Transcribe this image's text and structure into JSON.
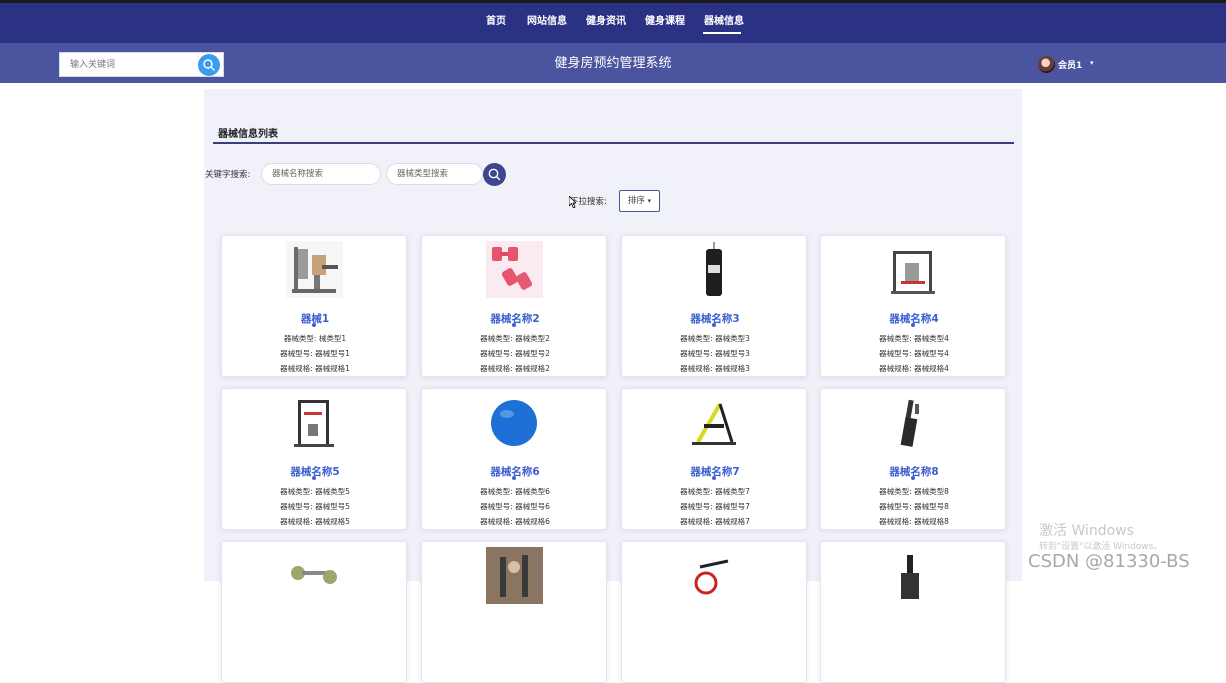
{
  "nav": {
    "items": [
      {
        "label": "首页"
      },
      {
        "label": "网站信息"
      },
      {
        "label": "健身资讯"
      },
      {
        "label": "健身课程"
      },
      {
        "label": "器械信息"
      }
    ],
    "active": "器械信息"
  },
  "header": {
    "search_placeholder": "输入关键词",
    "title": "健身房预约管理系统",
    "user_name": "会员1",
    "user_caret": "▾"
  },
  "main": {
    "section_title": "器械信息列表",
    "keyword_label": "关键字搜索:",
    "name_placeholder": "器械名称搜索",
    "type_placeholder": "器械类型搜索",
    "dropdown_label": "下拉搜索:",
    "sort_label": "排序",
    "sort_caret": "▾"
  },
  "cards": [
    {
      "name": "器械1",
      "type": "器械类型: 械类型1",
      "model": "器械型号: 器械型号1",
      "spec": "器械规格: 器械规格1",
      "icon": "cable-machine-icon"
    },
    {
      "name": "器械名称2",
      "type": "器械类型: 器械类型2",
      "model": "器械型号: 器械型号2",
      "spec": "器械规格: 器械规格2",
      "icon": "dumbbell-icon"
    },
    {
      "name": "器械名称3",
      "type": "器械类型: 器械类型3",
      "model": "器械型号: 器械型号3",
      "spec": "器械规格: 器械规格3",
      "icon": "punching-bag-icon"
    },
    {
      "name": "器械名称4",
      "type": "器械类型: 器械类型4",
      "model": "器械型号: 器械型号4",
      "spec": "器械规格: 器械规格4",
      "icon": "home-gym-icon"
    },
    {
      "name": "器械名称5",
      "type": "器械类型: 器械类型5",
      "model": "器械型号: 器械型号5",
      "spec": "器械规格: 器械规格5",
      "icon": "power-rack-icon"
    },
    {
      "name": "器械名称6",
      "type": "器械类型: 器械类型6",
      "model": "器械型号: 器械型号6",
      "spec": "器械规格: 器械规格6",
      "icon": "exercise-ball-icon"
    },
    {
      "name": "器械名称7",
      "type": "器械类型: 器械类型7",
      "model": "器械型号: 器械型号7",
      "spec": "器械规格: 器械规格7",
      "icon": "ab-machine-icon"
    },
    {
      "name": "器械名称8",
      "type": "器械类型: 器械类型8",
      "model": "器械型号: 器械型号8",
      "spec": "器械规格: 器械规格8",
      "icon": "treadmill-icon"
    },
    {
      "icon": "dumbbell-set-icon"
    },
    {
      "icon": "gym-photo-icon"
    },
    {
      "icon": "spin-bike-icon"
    },
    {
      "icon": "treadmill-icon"
    }
  ],
  "watermark": {
    "line1": "激活 Windows",
    "line2": "转到\"设置\"以激活 Windows。",
    "csdn": "CSDN @81330-BS"
  },
  "colors": {
    "topnav": "#2b3283",
    "header": "#4b559f",
    "accent_blue": "#3b9bf0",
    "card_title": "#3c5fd0"
  }
}
